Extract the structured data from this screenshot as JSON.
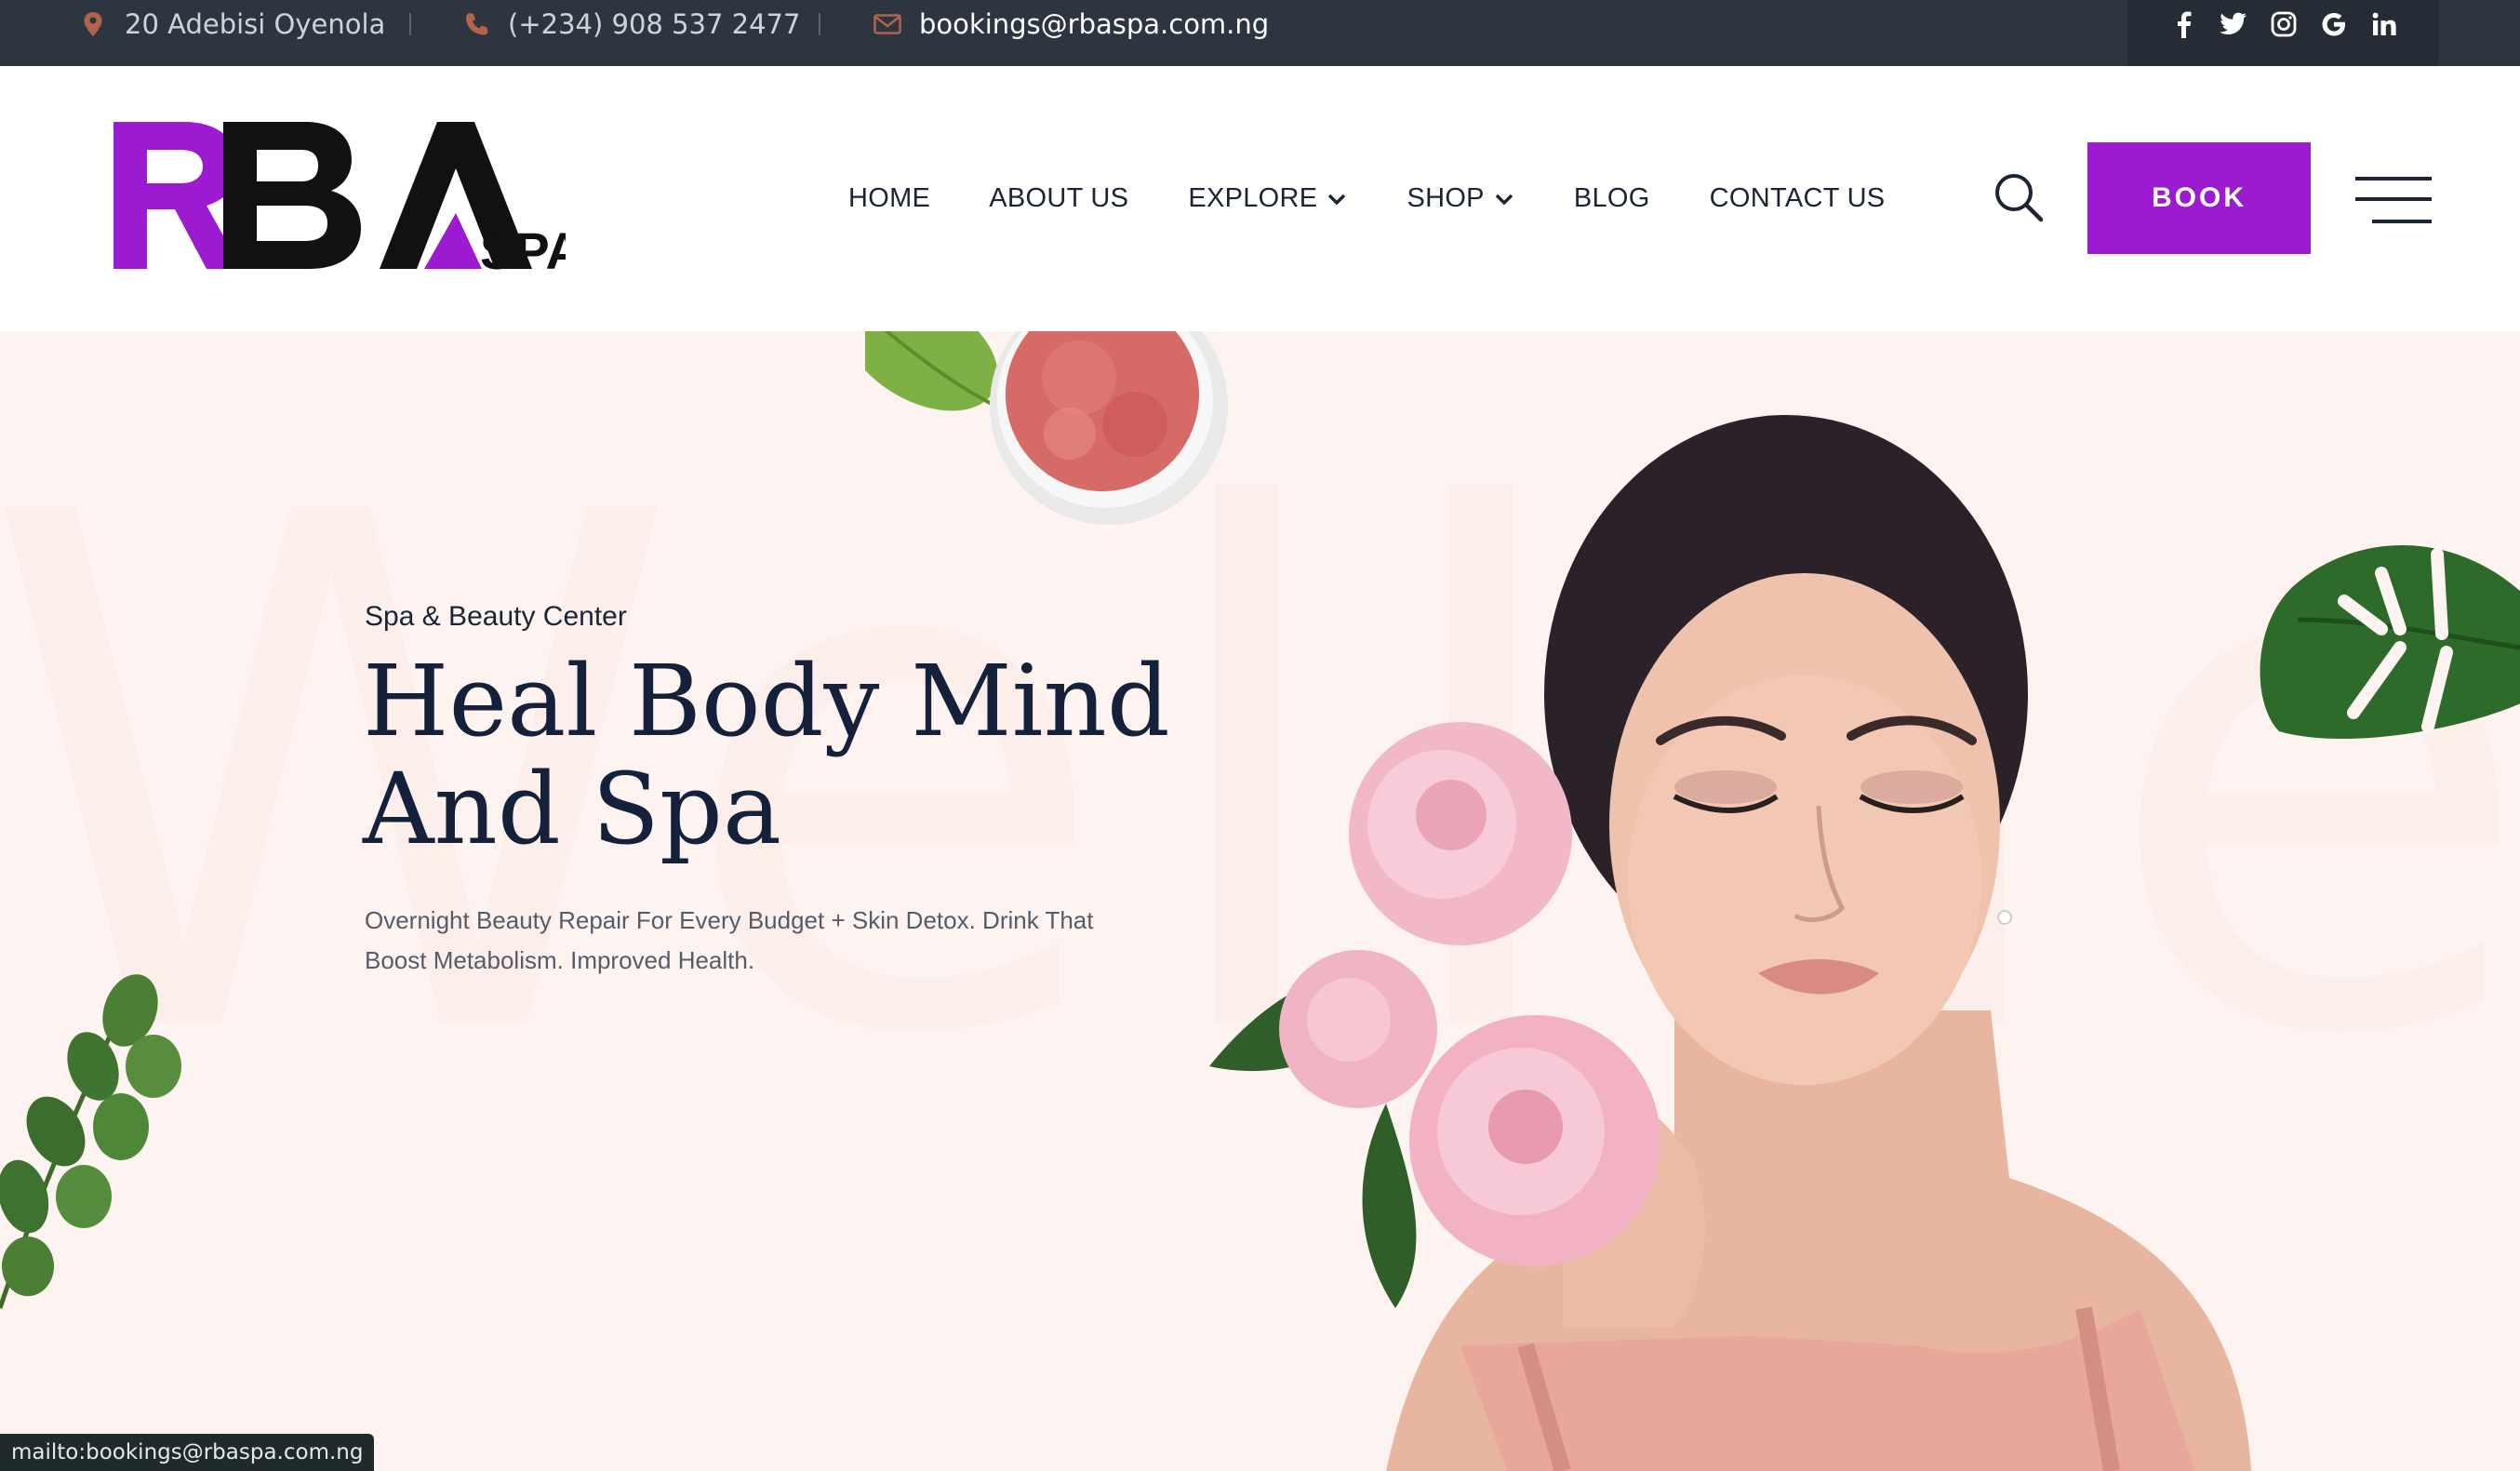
{
  "topbar": {
    "address": "20 Adebisi Oyenola",
    "phone": "(+234) 908 537 2477",
    "email": "bookings@rbaspa.com.ng",
    "social": [
      "facebook-icon",
      "twitter-icon",
      "instagram-icon",
      "google-icon",
      "linkedin-icon"
    ],
    "icon_color": "#b5624a"
  },
  "header": {
    "logo_text": "RBA",
    "logo_suffix": "SPA",
    "brand_color": "#9c1bd0",
    "nav": [
      {
        "label": "HOME"
      },
      {
        "label": "ABOUT US"
      },
      {
        "label": "EXPLORE",
        "dropdown": true
      },
      {
        "label": "SHOP",
        "dropdown": true
      },
      {
        "label": "BLOG"
      },
      {
        "label": "CONTACT US"
      }
    ],
    "book_label": "BOOK"
  },
  "hero": {
    "watermark": "Wellnez",
    "eyebrow": "Spa & Beauty Center",
    "title_line1": "Heal Body Mind",
    "title_line2": "And Spa",
    "subtitle_line1": "Overnight Beauty Repair For Every Budget + Skin Detox. Drink That",
    "subtitle_line2": "Boost Metabolism. Improved Health."
  },
  "statusbar": {
    "text": "mailto:bookings@rbaspa.com.ng"
  }
}
